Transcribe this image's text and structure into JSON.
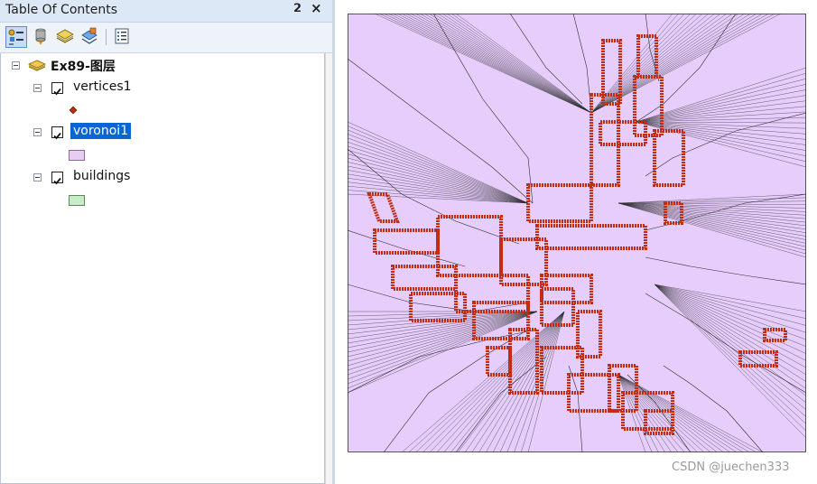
{
  "toc": {
    "title": "Table Of Contents",
    "pin_glyph": "⬑",
    "close_glyph": "×",
    "toolbar": [
      {
        "name": "list-by-drawing-order-icon",
        "active": true
      },
      {
        "name": "list-by-source-icon",
        "active": false
      },
      {
        "name": "list-by-visibility-icon",
        "active": false
      },
      {
        "name": "list-by-selection-icon",
        "active": false
      },
      {
        "name": "options-icon",
        "active": false
      }
    ],
    "layer_group": {
      "label": "Ex89-图层",
      "expanded": true
    },
    "layers": [
      {
        "label": "vertices1",
        "checked": true,
        "selected": false,
        "symbol": "point",
        "symbol_color": "#b5300f"
      },
      {
        "label": "voronoi1",
        "checked": true,
        "selected": true,
        "symbol": "polygon",
        "symbol_color": "#e8ccf4"
      },
      {
        "label": "buildings",
        "checked": true,
        "selected": false,
        "symbol": "polygon",
        "symbol_color": "#c8ebc8"
      }
    ]
  },
  "map": {
    "voronoi_fill": "#e6cdfb",
    "edge_color": "#2d2d2d",
    "vertex_color": "#c12c13",
    "frame_border": "#555555"
  },
  "watermark": "CSDN @juechen333"
}
